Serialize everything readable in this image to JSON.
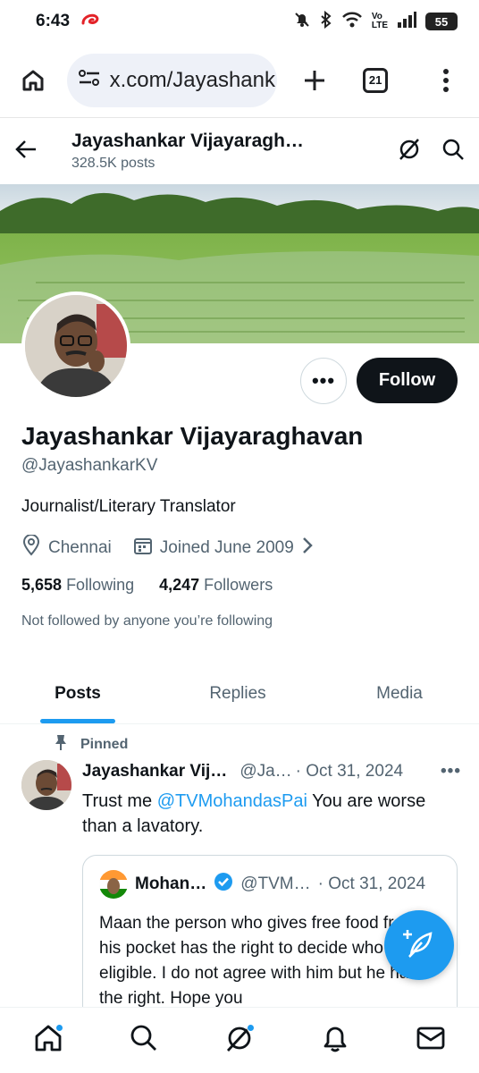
{
  "status_bar": {
    "time": "6:43",
    "battery": "55"
  },
  "browser": {
    "url": "x.com/Jayashank",
    "tabs_count": "21"
  },
  "header": {
    "name": "Jayashankar Vijayaragh…",
    "posts_count": "328.5K posts"
  },
  "profile": {
    "display_name": "Jayashankar Vijayaraghavan",
    "handle": "@JayashankarKV",
    "bio": "Journalist/Literary Translator",
    "location": "Chennai",
    "joined": "Joined June 2009",
    "following_count": "5,658",
    "following_label": "Following",
    "followers_count": "4,247",
    "followers_label": "Followers",
    "not_followed": "Not followed by anyone you’re following",
    "follow_label": "Follow",
    "more_label": "•••"
  },
  "tabs": [
    {
      "label": "Posts",
      "active": true
    },
    {
      "label": "Replies",
      "active": false
    },
    {
      "label": "Media",
      "active": false
    }
  ],
  "post": {
    "pinned_label": "Pinned",
    "author": "Jayashankar Vij…",
    "handle": "@Ja…",
    "date": "· Oct 31, 2024",
    "more": "•••",
    "text_before": "Trust me ",
    "mention": "@TVMohandasPai",
    "text_after": " You are worse than a lavatory.",
    "quote": {
      "author": "Mohan…",
      "handle": "@TVM…",
      "date": "· Oct 31, 2024",
      "text": "Maan the person who gives free food from his pocket has the right to decide who is eligible. I do not agree with him but he has the right. Hope you"
    }
  },
  "colors": {
    "accent": "#1d9bf0",
    "text": "#0f1419",
    "muted": "#536471"
  }
}
